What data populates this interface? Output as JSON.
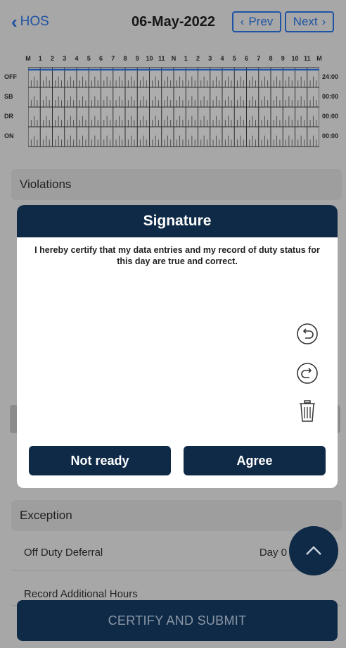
{
  "header": {
    "back_label": "HOS",
    "date": "06-May-2022",
    "prev_label": "Prev",
    "next_label": "Next"
  },
  "log_grid": {
    "hours": [
      "M",
      "1",
      "2",
      "3",
      "4",
      "5",
      "6",
      "7",
      "8",
      "9",
      "10",
      "11",
      "N",
      "1",
      "2",
      "3",
      "4",
      "5",
      "6",
      "7",
      "8",
      "9",
      "10",
      "11",
      "M"
    ],
    "rows": [
      {
        "label": "OFF",
        "total": "24:00"
      },
      {
        "label": "SB",
        "total": "00:00"
      },
      {
        "label": "DR",
        "total": "00:00"
      },
      {
        "label": "ON",
        "total": "00:00"
      }
    ]
  },
  "sections": {
    "violations": "Violations",
    "exception": "Exception",
    "off_duty_deferral": "Off Duty Deferral",
    "off_duty_value": "Day 0",
    "record_additional_hours": "Record Additional Hours"
  },
  "modal": {
    "title": "Signature",
    "certification_text": "I hereby certify that my data entries and my record of duty status for this day are true and correct.",
    "not_ready_label": "Not ready",
    "agree_label": "Agree"
  },
  "footer": {
    "certify_label": "CERTIFY AND SUBMIT"
  },
  "colors": {
    "primary_navy": "#0f2a47",
    "link_blue": "#2f7bf2"
  }
}
